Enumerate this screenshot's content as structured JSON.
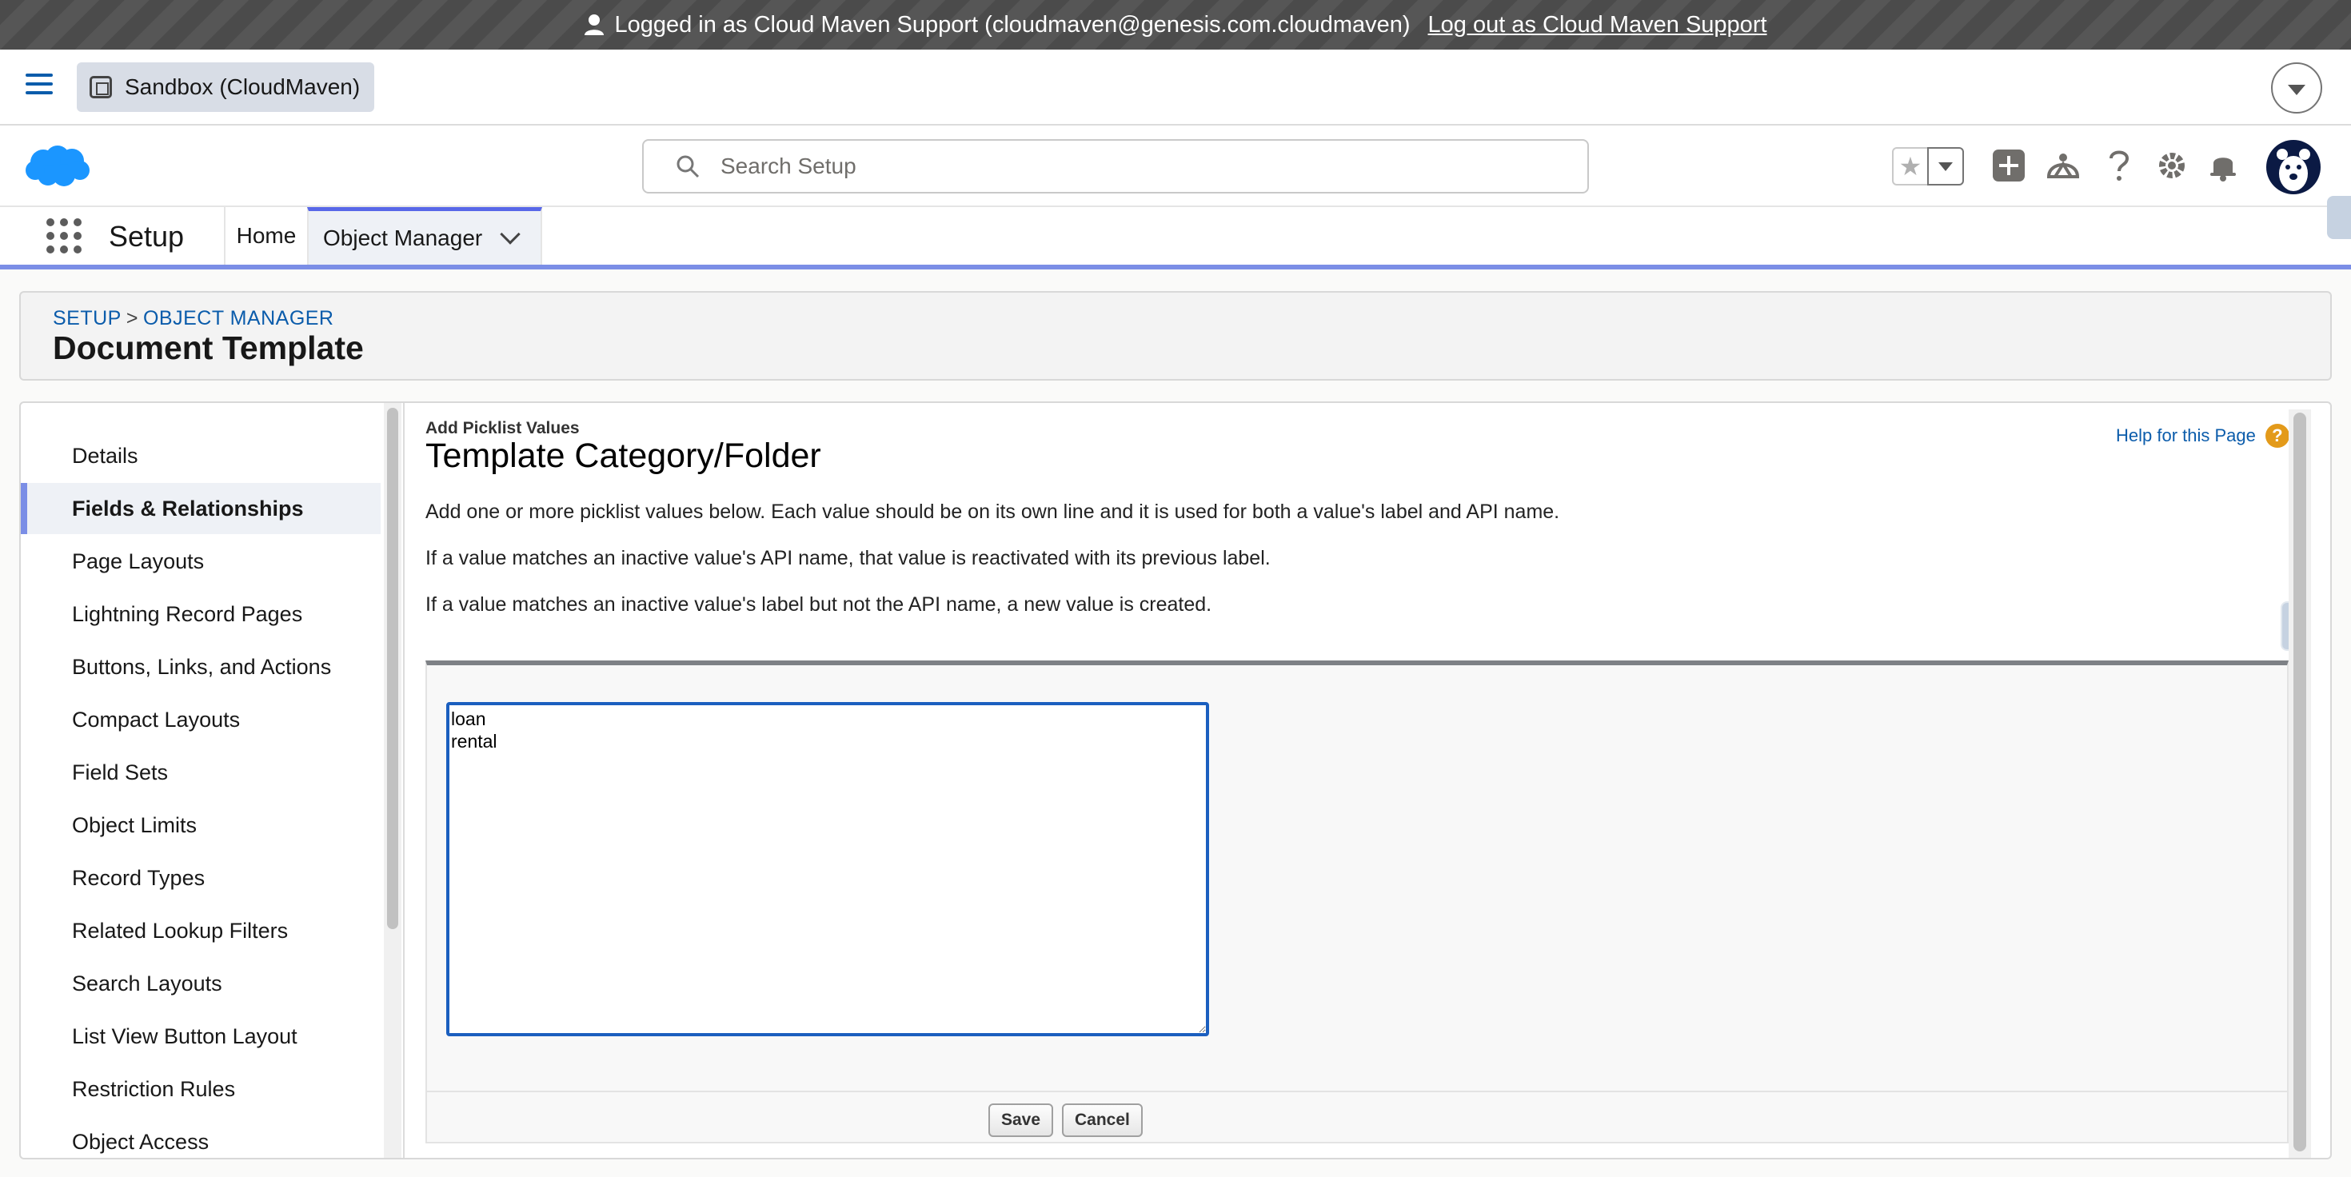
{
  "banner": {
    "text": "Logged in as Cloud Maven Support (cloudmaven@genesis.com.cloudmaven)",
    "logout_link": "Log out as Cloud Maven Support"
  },
  "sandbox": {
    "label": "Sandbox (CloudMaven)"
  },
  "header": {
    "search_placeholder": "Search Setup",
    "icons": [
      "favorites-star",
      "favorites-dropdown",
      "global-actions-plus",
      "trailhead",
      "help",
      "setup-gear",
      "notifications-bell",
      "user-avatar"
    ]
  },
  "nav": {
    "app_name": "Setup",
    "tabs": [
      {
        "label": "Home"
      },
      {
        "label": "Object Manager"
      }
    ]
  },
  "page": {
    "breadcrumb": {
      "setup": "SETUP",
      "separator": ">",
      "object_manager": "OBJECT MANAGER"
    },
    "title": "Document Template"
  },
  "sidebar": {
    "items": [
      {
        "label": "Details"
      },
      {
        "label": "Fields & Relationships"
      },
      {
        "label": "Page Layouts"
      },
      {
        "label": "Lightning Record Pages"
      },
      {
        "label": "Buttons, Links, and Actions"
      },
      {
        "label": "Compact Layouts"
      },
      {
        "label": "Field Sets"
      },
      {
        "label": "Object Limits"
      },
      {
        "label": "Record Types"
      },
      {
        "label": "Related Lookup Filters"
      },
      {
        "label": "Search Layouts"
      },
      {
        "label": "List View Button Layout"
      },
      {
        "label": "Restriction Rules"
      },
      {
        "label": "Object Access"
      }
    ],
    "active": "Fields & Relationships"
  },
  "edit": {
    "kicker": "Add Picklist Values",
    "title": "Template Category/Folder",
    "help_link": "Help for this Page",
    "paragraphs": [
      "Add one or more picklist values below. Each value should be on its own line and it is used for both a value's label and API name.",
      "If a value matches an inactive value's API name, that value is reactivated with its previous label.",
      "If a value matches an inactive value's label but not the API name, a new value is created."
    ],
    "textarea_value": "loan\nrental",
    "save_label": "Save",
    "cancel_label": "Cancel"
  },
  "colors": {
    "brand_blue": "#0b5cab",
    "nav_accent": "#7b8ee6",
    "help_orange": "#e39a1a"
  }
}
